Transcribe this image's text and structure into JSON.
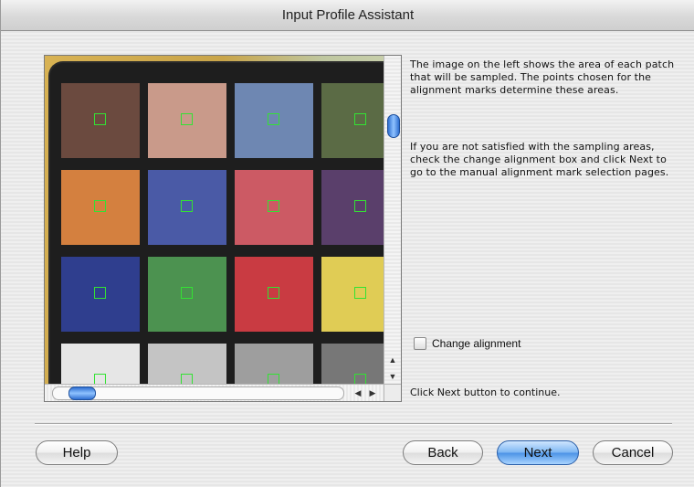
{
  "window": {
    "title": "Input Profile Assistant"
  },
  "image_panel": {
    "patches": [
      {
        "color": "#6b4a3f"
      },
      {
        "color": "#c99a8a"
      },
      {
        "color": "#6e87b2"
      },
      {
        "color": "#5b6b45"
      },
      {
        "color": "#d4803f"
      },
      {
        "color": "#4a5aa6"
      },
      {
        "color": "#cc5a64"
      },
      {
        "color": "#5a3f6b"
      },
      {
        "color": "#2f3e8e"
      },
      {
        "color": "#4c9250"
      },
      {
        "color": "#c93b42"
      },
      {
        "color": "#e0cc55"
      },
      {
        "color": "#e6e6e6"
      },
      {
        "color": "#c4c4c4"
      },
      {
        "color": "#9e9e9e"
      },
      {
        "color": "#777777"
      }
    ],
    "marker_color": "#33e233",
    "vscroll_arrows": {
      "up": "▲",
      "down": "▼"
    },
    "hscroll_arrows": {
      "left": "◀",
      "right": "▶"
    }
  },
  "instructions": {
    "paragraph1": "The image on the left shows the area of each patch that will be sampled. The points chosen for the alignment marks determine these areas.",
    "paragraph2": "If you are not satisfied with the sampling areas, check the change alignment box and click Next to go to the manual alignment mark selection pages."
  },
  "change_alignment": {
    "label": "Change alignment",
    "checked": false
  },
  "continue_note": "Click Next button to continue.",
  "buttons": {
    "help": "Help",
    "back": "Back",
    "next": "Next",
    "cancel": "Cancel"
  }
}
